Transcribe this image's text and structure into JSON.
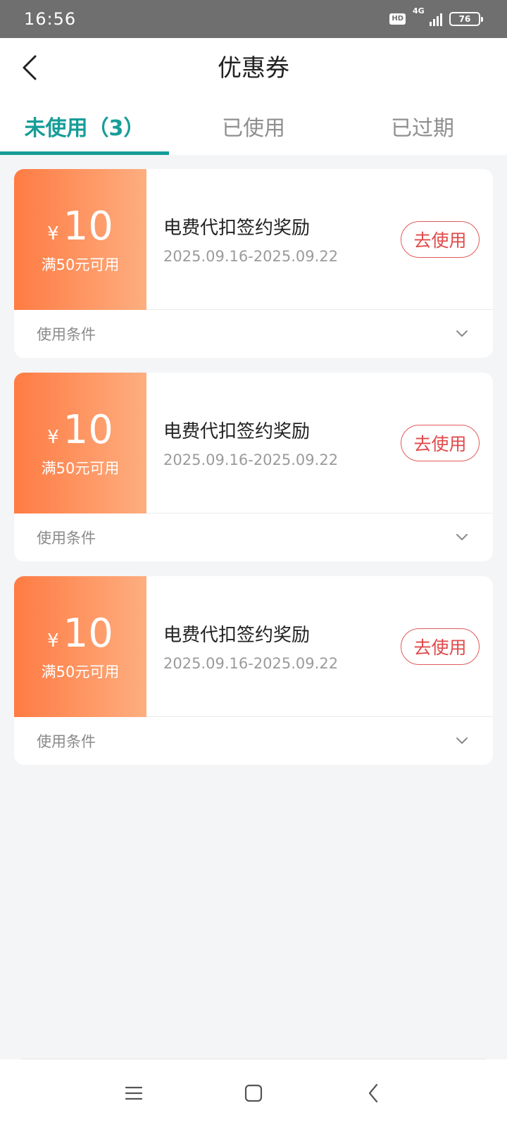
{
  "status_bar": {
    "time": "16:56",
    "hd": "HD",
    "network": "4G",
    "battery": "76"
  },
  "header": {
    "title": "优惠券"
  },
  "tabs": [
    {
      "label": "未使用（3）",
      "active": true
    },
    {
      "label": "已使用",
      "active": false
    },
    {
      "label": "已过期",
      "active": false
    }
  ],
  "coupons": [
    {
      "currency": "¥",
      "amount": "10",
      "threshold": "满50元可用",
      "name": "电费代扣签约奖励",
      "date_range": "2025.09.16-2025.09.22",
      "action": "去使用",
      "conditions_label": "使用条件"
    },
    {
      "currency": "¥",
      "amount": "10",
      "threshold": "满50元可用",
      "name": "电费代扣签约奖励",
      "date_range": "2025.09.16-2025.09.22",
      "action": "去使用",
      "conditions_label": "使用条件"
    },
    {
      "currency": "¥",
      "amount": "10",
      "threshold": "满50元可用",
      "name": "电费代扣签约奖励",
      "date_range": "2025.09.16-2025.09.22",
      "action": "去使用",
      "conditions_label": "使用条件"
    }
  ],
  "colors": {
    "accent": "#179d98",
    "coupon_gradient_start": "#ff7b43",
    "coupon_gradient_end": "#fdae80",
    "action_red": "#e04a4a"
  },
  "icons": {
    "back": "chevron-left-icon",
    "expand": "chevron-down-icon",
    "nav_menu": "menu-icon",
    "nav_home": "home-square-icon",
    "nav_back": "back-icon"
  }
}
